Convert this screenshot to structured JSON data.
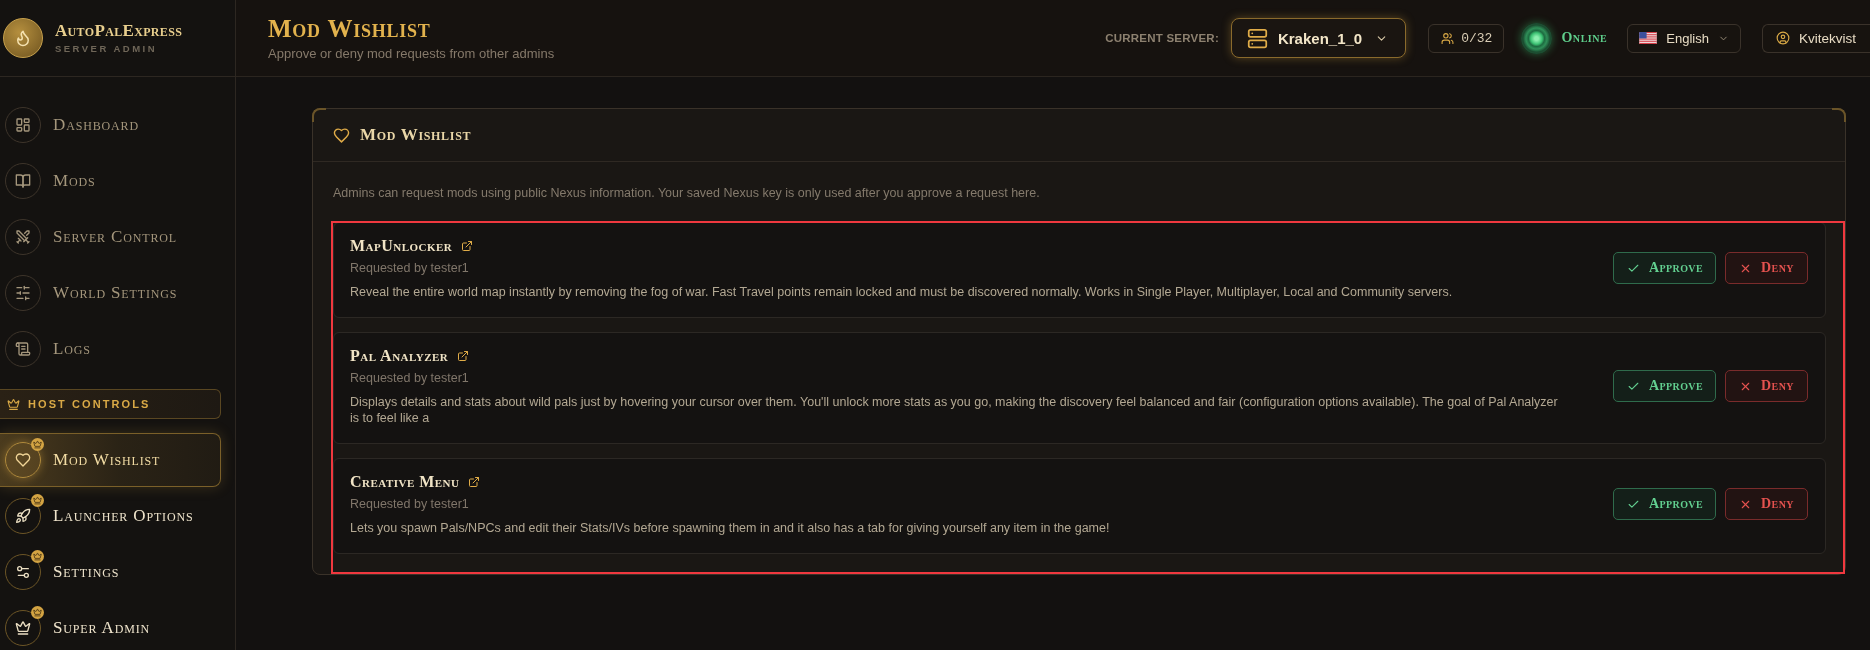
{
  "brand": {
    "name": "AutoPalExpress",
    "tagline": "SERVER ADMIN"
  },
  "sidebar": {
    "items": [
      {
        "label": "Dashboard",
        "selected": false
      },
      {
        "label": "Mods",
        "selected": false
      },
      {
        "label": "Server Control",
        "selected": false
      },
      {
        "label": "World Settings",
        "selected": false
      },
      {
        "label": "Logs",
        "selected": false
      }
    ],
    "host_controls": {
      "title": "HOST CONTROLS",
      "items": [
        {
          "label": "Mod Wishlist",
          "selected": true
        },
        {
          "label": "Launcher Options",
          "selected": false
        },
        {
          "label": "Settings",
          "selected": false
        },
        {
          "label": "Super Admin",
          "selected": false
        }
      ]
    }
  },
  "page_header": {
    "title": "Mod Wishlist",
    "subtitle": "Approve or deny mod requests from other admins"
  },
  "top_bar": {
    "server_label": "CURRENT SERVER:",
    "server": "Kraken_1_0",
    "players": "0/32",
    "status": {
      "label": "Online",
      "online": true
    },
    "language": "English",
    "user": "Kvitekvist"
  },
  "wishlist": {
    "title": "Mod Wishlist",
    "info": "Admins can request mods using public Nexus information. Your saved Nexus key is only used after you approve a request here.",
    "requests": [
      {
        "name": "MapUnlocker",
        "requested_by": "Requested by tester1",
        "description": "Reveal the entire world map instantly by removing the fog of war. Fast Travel points remain locked and must be discovered normally. Works in Single Player, Multiplayer, Local and Community servers.",
        "approve": "Approve",
        "deny": "Deny"
      },
      {
        "name": "Pal Analyzer",
        "requested_by": "Requested by tester1",
        "description": "Displays details and stats about wild pals just by hovering your cursor over them. You'll unlock more stats as you go, making the discovery feel balanced and fair (configuration options available). The goal of Pal Analyzer is to feel like a",
        "approve": "Approve",
        "deny": "Deny"
      },
      {
        "name": "Creative Menu",
        "requested_by": "Requested by tester1",
        "description": "Lets you spawn Pals/NPCs and edit their Stats/IVs before spawning them in and it also has a tab for giving yourself any item in the game!",
        "approve": "Approve",
        "deny": "Deny"
      }
    ]
  }
}
